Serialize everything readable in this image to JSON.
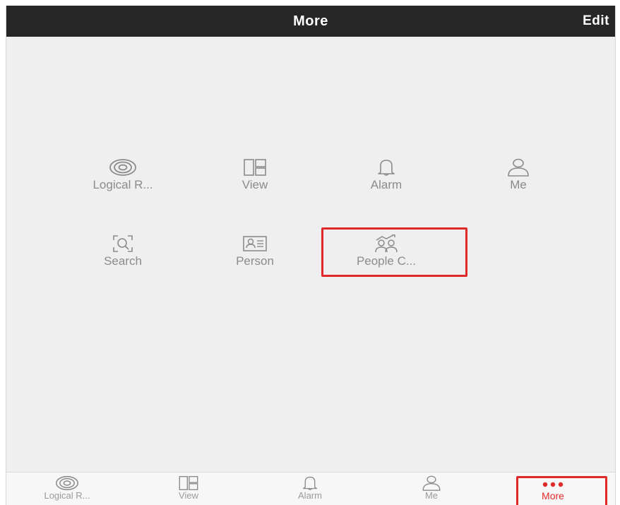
{
  "header": {
    "title": "More",
    "edit_label": "Edit"
  },
  "grid": {
    "items": [
      {
        "label": "Logical R...",
        "icon": "target-icon"
      },
      {
        "label": "View",
        "icon": "layout-grid-icon"
      },
      {
        "label": "Alarm",
        "icon": "bell-icon"
      },
      {
        "label": "Me",
        "icon": "person-icon"
      },
      {
        "label": "Search",
        "icon": "face-scan-icon"
      },
      {
        "label": "Person",
        "icon": "id-card-icon"
      },
      {
        "label": "People C...",
        "icon": "people-count-icon"
      }
    ],
    "highlighted_item": "People C..."
  },
  "tabbar": {
    "tabs": [
      {
        "label": "Logical R...",
        "icon": "target-icon"
      },
      {
        "label": "View",
        "icon": "layout-grid-icon"
      },
      {
        "label": "Alarm",
        "icon": "bell-icon"
      },
      {
        "label": "Me",
        "icon": "person-icon"
      },
      {
        "label": "More",
        "icon": "more-dots-icon",
        "active": true
      }
    ]
  },
  "colors": {
    "header_bg": "#262626",
    "content_bg": "#efefef",
    "accent_red": "#e02a2a",
    "icon_gray": "#8b8b8b"
  }
}
